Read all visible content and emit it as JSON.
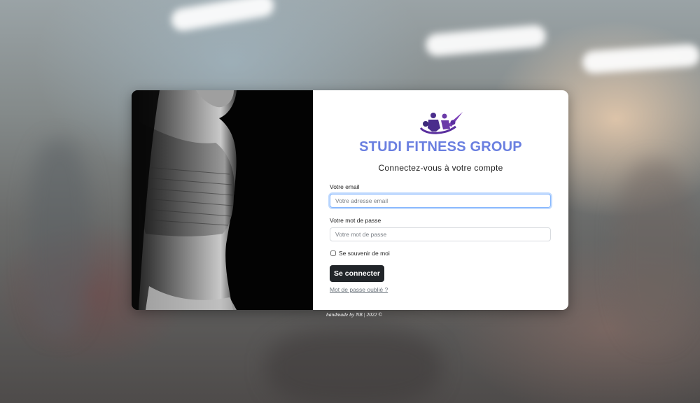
{
  "brand": {
    "title": "STUDI FITNESS GROUP",
    "subtitle": "Connectez-vous à votre compte",
    "accent_color": "#6a7fe0",
    "logo_icon": "athletes-logo-icon"
  },
  "form": {
    "email": {
      "label": "Votre email",
      "placeholder": "Votre adresse email",
      "value": ""
    },
    "password": {
      "label": "Votre mot de passe",
      "placeholder": "Votre mot de passe",
      "value": ""
    },
    "remember": {
      "label": "Se souvenir de moi",
      "checked": false
    },
    "submit_label": "Se connecter",
    "forgot_label": "Mot de passe oublié ?"
  },
  "footer": {
    "text": "handmade by NB | 2022 ©"
  }
}
